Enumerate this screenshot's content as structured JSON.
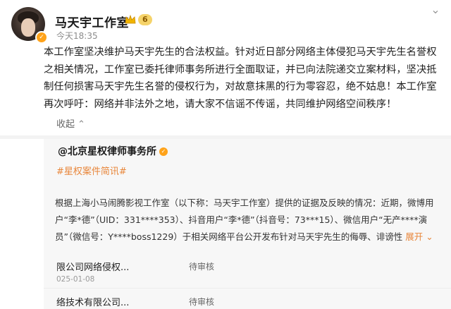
{
  "post": {
    "account_name": "马天宇工作室",
    "level_badge": "6",
    "timestamp": "今天18:35",
    "content": "本工作室坚决维护马天宇先生的合法权益。针对近日部分网络主体侵犯马天宇先生名誉权之相关情况，工作室已委托律师事务所进行全面取证，并已向法院递交立案材料，坚决抵制任何损害马天宇先生名誉的侵权行为，对故意抹黑的行为零容忍，绝不姑息！本工作室再次呼吁：网络并非法外之地，请大家不信谣不传谣，共同维护网络空间秩序！",
    "collapse_label": "收起"
  },
  "repost": {
    "mention": "@北京星权律师事务所",
    "topic": "#星权案件简讯#",
    "text": "根据上海小马闹腾影视工作室（以下称：马天宇工作室）提供的证据及反映的情况：近期，微博用户“李*德”（UID：331****353）、抖音用户“李*德”（抖音号：73***15）、微信用户“无产****演员”（微信号：Y****boss1229）于相关网络平台公开发布针对马天宇先生的侮辱、诽谤性",
    "expand_label": "展开",
    "cases": [
      {
        "party": "限公司网络侵权...",
        "status": "待审核",
        "date": "025-01-08"
      },
      {
        "party": "络技术有限公司...",
        "status": "待审核",
        "date": ""
      }
    ]
  },
  "icons": {
    "verified": "verified-badge-icon",
    "crown": "crown-icon",
    "menu": "chevron-down-icon"
  },
  "colors": {
    "verified": "#ffa31a",
    "topic": "#e8863a",
    "level_badge": "#f5d36a"
  }
}
